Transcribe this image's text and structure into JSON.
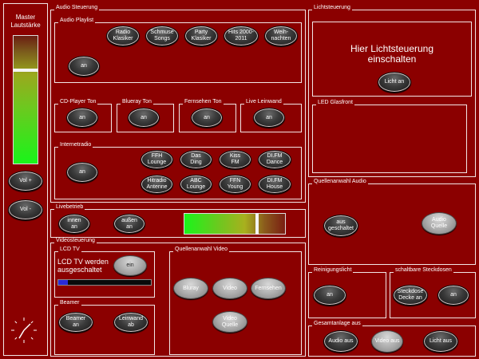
{
  "master": {
    "title_line1": "Master",
    "title_line2": "Lautstärke",
    "volume_level": 0.6,
    "vol_up": "Vol +",
    "vol_down": "Vol -"
  },
  "audio": {
    "section": "Audio Steuerung",
    "playlist": {
      "title": "Audio Playlist",
      "buttons": [
        "Radio\nKlasiker",
        "Schmuse\nSongs",
        "Party\nKlasiker",
        "Hits 2000-\n2011",
        "Weih-\nnachten"
      ],
      "on": "an"
    },
    "cd": {
      "title": "CD-Player Ton",
      "on": "an"
    },
    "bluray": {
      "title": "Blueray Ton",
      "on": "an"
    },
    "tv": {
      "title": "Fernsehen Ton",
      "on": "an"
    },
    "live": {
      "title": "Live Leinwand",
      "on": "an"
    },
    "radio": {
      "title": "Internetradio",
      "on": "an",
      "stations": [
        "FFH\nLounge",
        "Das\nDing",
        "Kiss\nFM",
        "DI.FM\nDance",
        "Hitradio\nAntenne",
        "ABC\nLounge",
        "FFN\nYoung",
        "DI.FM\nHouse"
      ]
    }
  },
  "live_ops": {
    "title": "Livebetrieb",
    "inside": "innen\nan",
    "outside": "außen\nan",
    "level": 0.82
  },
  "video": {
    "section": "Videosteuerung",
    "lcd": {
      "title": "LCD TV",
      "status": "LCD TV werden\nausgeschaltet",
      "on": "ein"
    },
    "beamer": {
      "title": "Beamer",
      "on": "Beamer\nan",
      "screen_down": "Leinwand\nab"
    },
    "source": {
      "title": "Quellenanwahl Video",
      "bluray": "Bluray",
      "video": "Video",
      "tv": "Fernsehen",
      "video_source": "Video\nQuelle"
    }
  },
  "light": {
    "section": "Lichtsteuerung",
    "message": "Hier Lichtsteuerung\neinschalten",
    "on": "Licht an"
  },
  "led": {
    "title": "LED Glasfront"
  },
  "audio_source": {
    "title": "Quellenanwahl Audio",
    "off": "aus\ngeschaltet",
    "source": "Audio\nQuelle"
  },
  "cleaning": {
    "title": "Reinigungslicht",
    "on": "an"
  },
  "sockets": {
    "title": "schaltbare Steckdosen",
    "ceiling": "Steckdose\nDecke an",
    "on": "an"
  },
  "system_off": {
    "title": "Gesamtanlage aus",
    "audio": "Audio aus",
    "video": "Video aus",
    "light": "Licht aus"
  }
}
